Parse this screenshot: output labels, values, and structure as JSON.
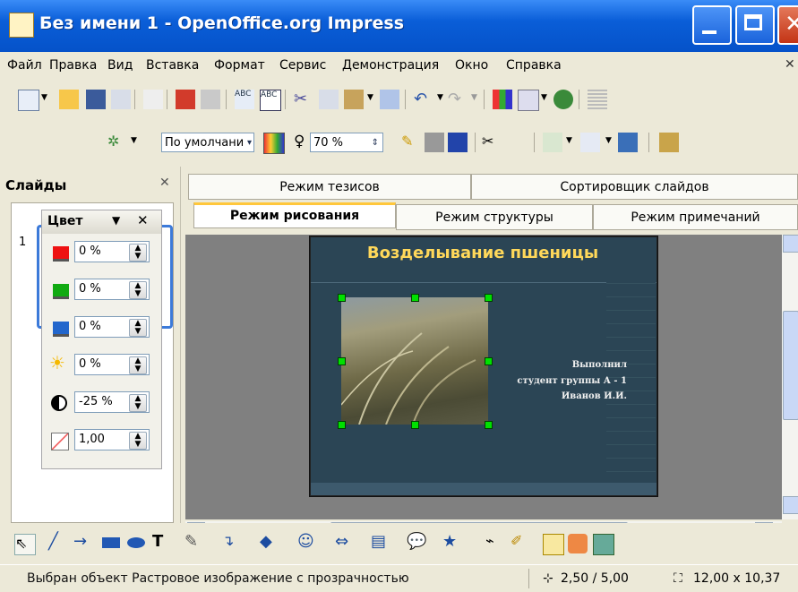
{
  "window": {
    "title": "Без имени 1 - OpenOffice.org Impress"
  },
  "menu": [
    "Файл",
    "Правка",
    "Вид",
    "Вставка",
    "Формат",
    "Сервис",
    "Демонстрация",
    "Окно",
    "Справка"
  ],
  "toolbar2": {
    "style_value": "По умолчани",
    "zoom_value": "70 %"
  },
  "slides_pane": {
    "title": "Слайды",
    "slide_number": "1"
  },
  "color_toolbar": {
    "title": "Цвет",
    "red": "0 %",
    "green": "0 %",
    "blue": "0 %",
    "brightness": "0 %",
    "contrast": "-25 %",
    "gamma": "1,00"
  },
  "tabs_row1": [
    "Режим тезисов",
    "Сортировщик слайдов"
  ],
  "tabs_row2": [
    "Режим рисования",
    "Режим структуры",
    "Режим примечаний"
  ],
  "slide": {
    "title": "Возделывание пшеницы",
    "text_line1": "Выполнил",
    "text_line2": "студент группы А - 1",
    "text_line3": "Иванов И.И."
  },
  "status": {
    "text": "Выбран объект Растровое изображение с прозрачностью",
    "position": "2,50 / 5,00",
    "size": "12,00 x 10,37"
  },
  "colors": {
    "titlebar": "#0a5ed8",
    "slide_bg": "#2b4555",
    "slide_title": "#ffd85a",
    "selection_handle": "#00e000"
  }
}
